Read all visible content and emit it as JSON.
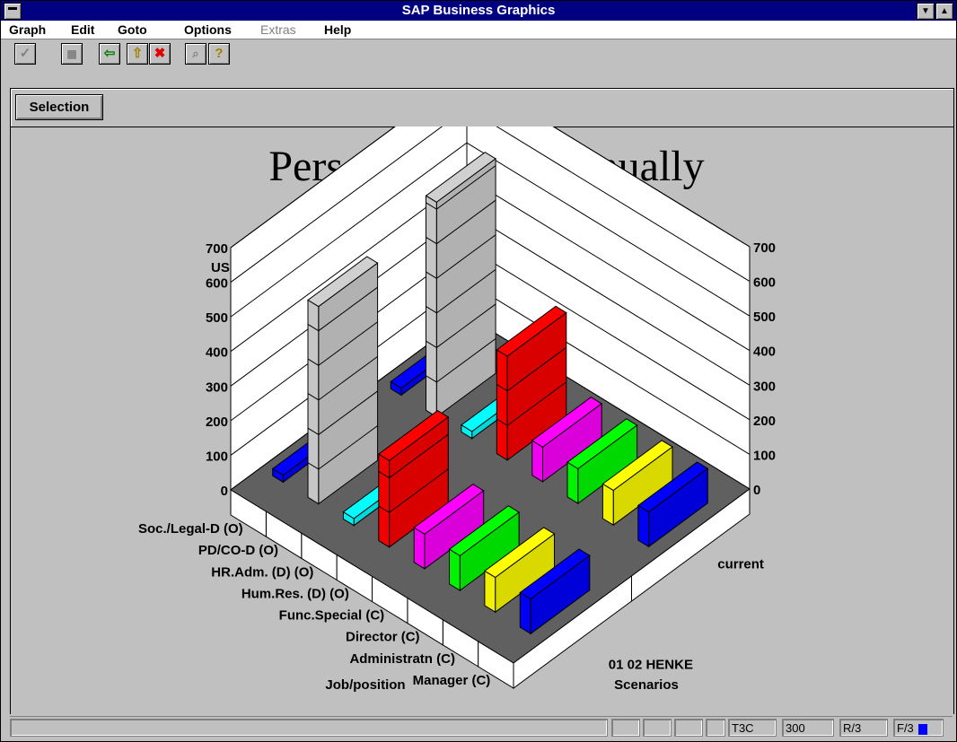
{
  "window": {
    "title": "SAP Business Graphics"
  },
  "menu": [
    "Graph",
    "Edit",
    "Goto",
    "Options",
    "Extras",
    "Help"
  ],
  "toolbar": {
    "selection_label": "Selection"
  },
  "status": {
    "session": "T3C",
    "client": "300",
    "system": "R/3",
    "mode": "F/3"
  },
  "chart_data": {
    "type": "bar",
    "title": "Personnel costs Annually",
    "zlabel": "USD (Thousands)",
    "xlabel": "Job/position",
    "ylabel": "Scenarios",
    "zlim": [
      0,
      700
    ],
    "zticks": [
      0,
      100,
      200,
      300,
      400,
      500,
      600,
      700
    ],
    "categories": [
      "Manager (C)",
      "Administratn (C)",
      "Director (C)",
      "Func.Special (C)",
      "Hum.Res. (D) (O)",
      "HR.Adm. (D) (O)",
      "PD/CO-D (O)",
      "Soc./Legal-D (O)"
    ],
    "scenarios": [
      "01 02 HENKE",
      "current"
    ],
    "series": [
      {
        "name": "current",
        "values": [
          100,
          100,
          100,
          100,
          300,
          20,
          620,
          20
        ]
      },
      {
        "name": "01 02 HENKE",
        "values": [
          100,
          100,
          100,
          100,
          250,
          20,
          570,
          20
        ]
      }
    ],
    "colors": [
      "#0000ff",
      "#ffff00",
      "#00ff00",
      "#ff00ff",
      "#ff0000",
      "#00ffff",
      "#d0d0d0",
      "#0000ff"
    ]
  }
}
